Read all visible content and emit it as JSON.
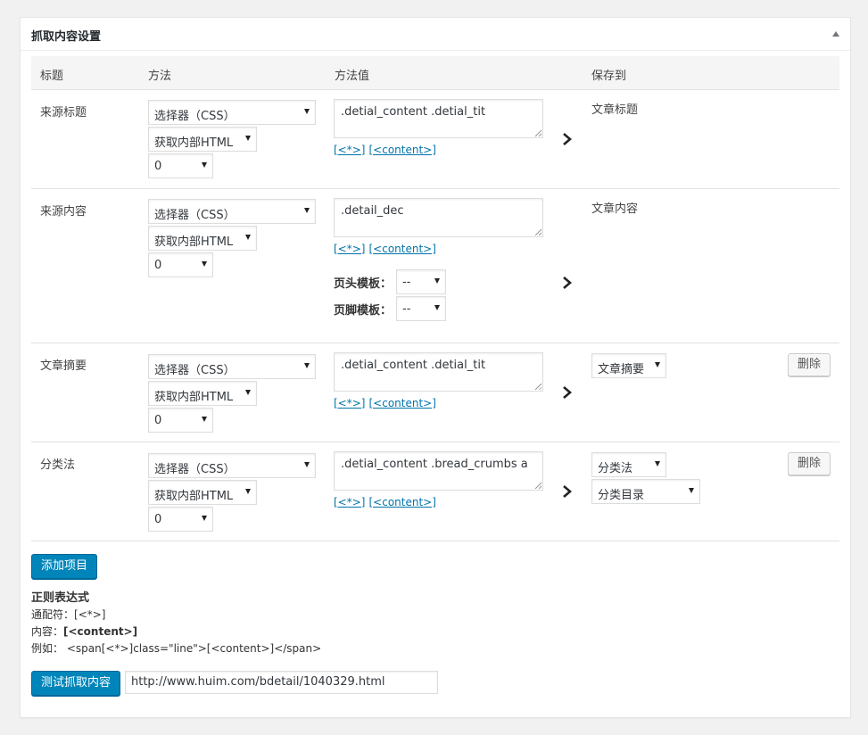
{
  "panel": {
    "title": "抓取内容设置"
  },
  "columns": {
    "title": "标题",
    "method": "方法",
    "method_value": "方法值",
    "save_to": "保存到"
  },
  "rows": [
    {
      "title": "来源标题",
      "selector": "选择器（CSS）",
      "extract": "获取内部HTML",
      "index": "0",
      "value": ".detial_content .detial_tit",
      "link_wildcard": "[<*>]",
      "link_content": "[<content>]",
      "save_text": "文章标题"
    },
    {
      "title": "来源内容",
      "selector": "选择器（CSS）",
      "extract": "获取内部HTML",
      "index": "0",
      "value": ".detail_dec",
      "link_wildcard": "[<*>]",
      "link_content": "[<content>]",
      "header_template_label": "页头模板：",
      "header_template_value": "--",
      "footer_template_label": "页脚模板：",
      "footer_template_value": "--",
      "save_text": "文章内容"
    },
    {
      "title": "文章摘要",
      "selector": "选择器（CSS）",
      "extract": "获取内部HTML",
      "index": "0",
      "value": ".detial_content .detial_tit",
      "link_wildcard": "[<*>]",
      "link_content": "[<content>]",
      "save_select": "文章摘要",
      "delete_label": "删除"
    },
    {
      "title": "分类法",
      "selector": "选择器（CSS）",
      "extract": "获取内部HTML",
      "index": "0",
      "value": ".detial_content .bread_crumbs a",
      "link_wildcard": "[<*>]",
      "link_content": "[<content>]",
      "save_select": "分类法",
      "save_select2": "分类目录",
      "delete_label": "删除"
    }
  ],
  "add_button": "添加项目",
  "regex": {
    "title": "正则表达式",
    "wildcard_label": "通配符：",
    "wildcard_value": "[<*>]",
    "content_label": "内容：",
    "content_value": "[<content>]",
    "example_label": "例如：",
    "example_value": "<span[<*>]class=\"line\">[<content>]</span>"
  },
  "test": {
    "button": "测试抓取内容",
    "url": "http://www.huim.com/bdetail/1040329.html"
  },
  "colors": {
    "primary": "#0085ba",
    "link": "#0073aa"
  }
}
